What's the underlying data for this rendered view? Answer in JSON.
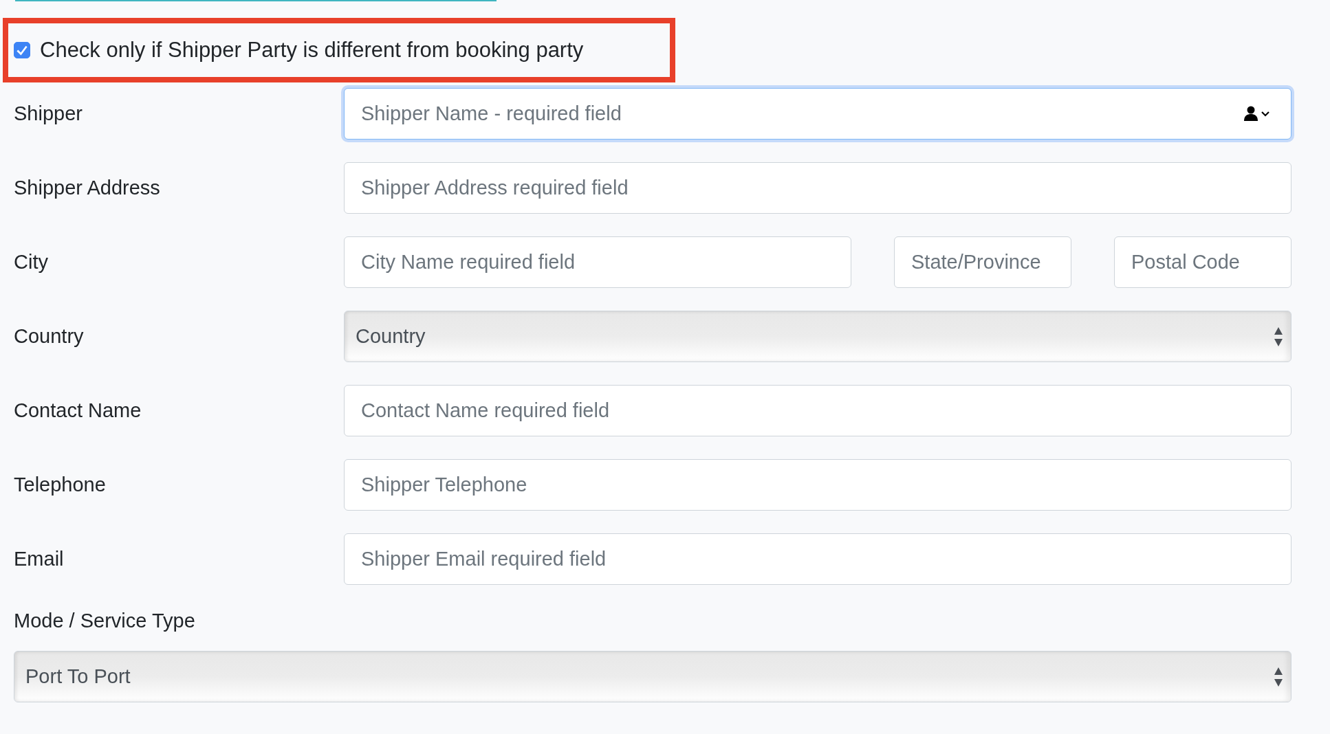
{
  "shipper_toggle": {
    "label": "Check only if Shipper Party is different from booking party",
    "checked": true,
    "highlighted": true
  },
  "rows": [
    {
      "label": "Shipper",
      "kind": "input",
      "fields": [
        {
          "placeholder": "Shipper Name - required field",
          "focused": true,
          "contact_picker": true
        }
      ]
    },
    {
      "label": "Shipper Address",
      "kind": "input",
      "fields": [
        {
          "placeholder": "Shipper Address required field",
          "focused": false
        }
      ]
    },
    {
      "label": "City",
      "kind": "input",
      "fields": [
        {
          "placeholder": "City Name required field",
          "focused": false
        },
        {
          "placeholder": "State/Province",
          "focused": false
        },
        {
          "placeholder": "Postal Code",
          "focused": false
        }
      ]
    },
    {
      "label": "Country",
      "kind": "select",
      "value": "Country"
    },
    {
      "label": "Contact Name",
      "kind": "input",
      "fields": [
        {
          "placeholder": "Contact Name required field",
          "focused": false
        }
      ]
    },
    {
      "label": "Telephone",
      "kind": "input",
      "fields": [
        {
          "placeholder": "Shipper Telephone",
          "focused": false
        }
      ]
    },
    {
      "label": "Email",
      "kind": "input",
      "fields": [
        {
          "placeholder": "Shipper Email required field",
          "focused": false
        }
      ]
    }
  ],
  "service_type": {
    "label": "Mode / Service Type",
    "value": "Port To Port"
  }
}
